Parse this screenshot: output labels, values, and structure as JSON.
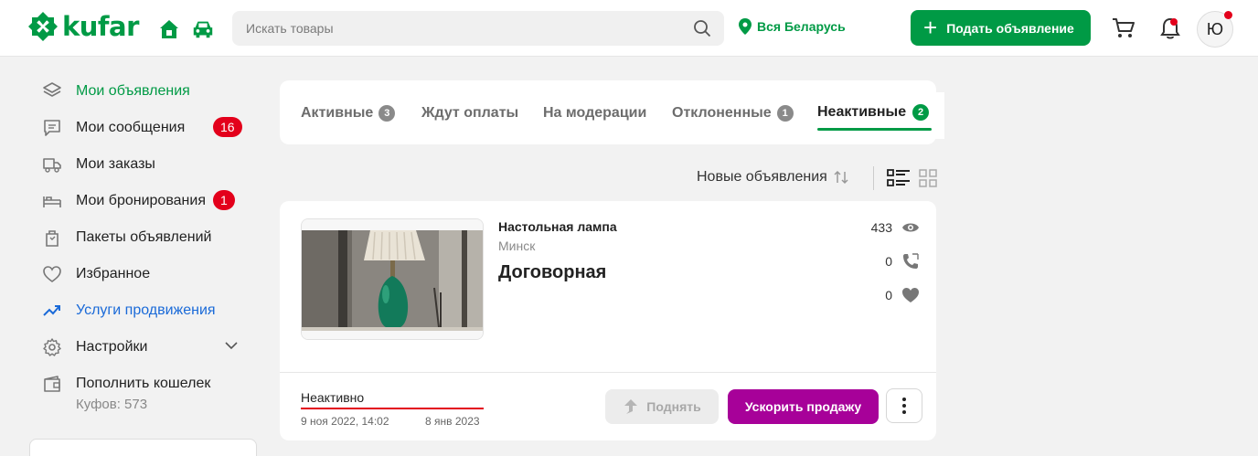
{
  "header": {
    "logo_text": "kufar",
    "search_placeholder": "Искать товары",
    "location": "Вся Беларусь",
    "post_button": "Подать объявление",
    "avatar_letter": "Ю"
  },
  "sidebar": {
    "items": [
      {
        "label": "Мои объявления",
        "icon": "layers-icon"
      },
      {
        "label": "Мои сообщения",
        "icon": "chat-icon",
        "badge": "16"
      },
      {
        "label": "Мои заказы",
        "icon": "delivery-icon"
      },
      {
        "label": "Мои бронирования",
        "icon": "bed-icon",
        "badge": "1"
      },
      {
        "label": "Пакеты объявлений",
        "icon": "bag-icon"
      },
      {
        "label": "Избранное",
        "icon": "heart-icon"
      },
      {
        "label": "Услуги продвижения",
        "icon": "trend-icon"
      },
      {
        "label": "Настройки",
        "icon": "gear-icon"
      },
      {
        "label": "Пополнить кошелек",
        "icon": "wallet-icon"
      }
    ],
    "wallet_balance": "Куфов: 573"
  },
  "tabs": [
    {
      "label": "Активные",
      "count": "3"
    },
    {
      "label": "Ждут оплаты"
    },
    {
      "label": "На модерации"
    },
    {
      "label": "Отклоненные",
      "count": "1"
    },
    {
      "label": "Неактивные",
      "count": "2"
    }
  ],
  "sort": {
    "label": "Новые объявления"
  },
  "ad": {
    "title": "Настольная лампа",
    "city": "Минск",
    "price": "Договорная",
    "views": "433",
    "calls": "0",
    "favorites": "0",
    "status": "Неактивно",
    "date_start": "9 ноя 2022, 14:02",
    "date_end": "8 янв 2023",
    "raise_button": "Поднять",
    "boost_button": "Ускорить продажу"
  },
  "colors": {
    "brand_green": "#009a45",
    "alert_red": "#e3001b",
    "boost_purple": "#a70199",
    "link_blue": "#1a6ad8"
  }
}
